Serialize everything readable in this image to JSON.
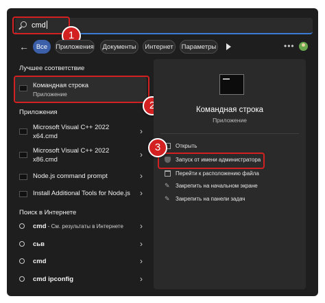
{
  "search": {
    "value": "cmd"
  },
  "filters": {
    "items": [
      {
        "label": "Все",
        "active": true
      },
      {
        "label": "Приложения",
        "active": false
      },
      {
        "label": "Документы",
        "active": false
      },
      {
        "label": "Интернет",
        "active": false
      },
      {
        "label": "Параметры",
        "active": false
      }
    ]
  },
  "best_match": {
    "section_title": "Лучшее соответствие",
    "name": "Командная строка",
    "type": "Приложение"
  },
  "apps": {
    "section_title": "Приложения",
    "items": [
      {
        "line1": "Microsoft Visual C++ 2022",
        "line2": "x64.cmd"
      },
      {
        "line1": "Microsoft Visual C++ 2022",
        "line2": "x86.cmd"
      },
      {
        "line1": "Node.js command prompt"
      },
      {
        "line1": "Install Additional Tools for Node.js"
      }
    ]
  },
  "web": {
    "section_title": "Поиск в Интернете",
    "items": [
      {
        "bold": "cmd",
        "rest": " - См. результаты в Интернете"
      },
      {
        "bold": "сьв",
        "rest": ""
      },
      {
        "bold": "cmd",
        "rest": ""
      },
      {
        "bold": "cmd ipconfig",
        "rest": ""
      }
    ]
  },
  "detail": {
    "title": "Командная строка",
    "subtitle": "Приложение",
    "actions": [
      {
        "label": "Открыть",
        "icon": "open-icon"
      },
      {
        "label": "Запуск от имени администратора",
        "icon": "shield-icon"
      },
      {
        "label": "Перейти к расположению файла",
        "icon": "folder-icon"
      },
      {
        "label": "Закрепить на начальном экране",
        "icon": "pin-icon"
      },
      {
        "label": "Закрепить на панели задач",
        "icon": "pin-icon"
      }
    ]
  },
  "badges": [
    "1",
    "2",
    "3"
  ],
  "colors": {
    "accent": "#3b5fa8",
    "highlight": "#d32020",
    "background": "#1e1e1e"
  }
}
